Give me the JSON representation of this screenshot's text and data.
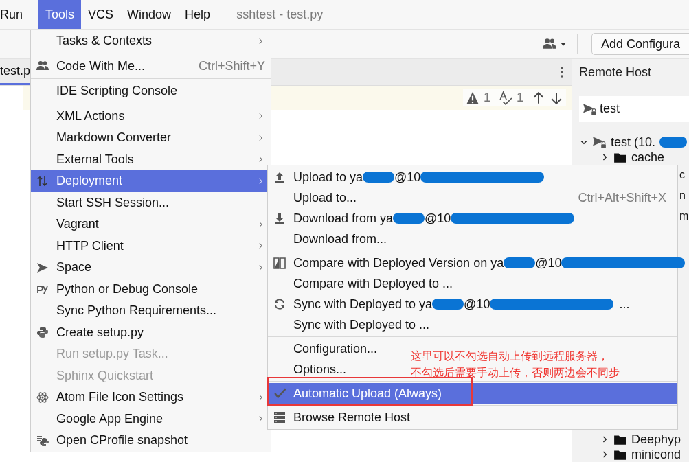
{
  "window": {
    "title": "sshtest - test.py"
  },
  "menubar": [
    {
      "label": "Run",
      "selected": false
    },
    {
      "label": "Tools",
      "selected": true
    },
    {
      "label": "VCS",
      "selected": false
    },
    {
      "label": "Window",
      "selected": false
    },
    {
      "label": "Help",
      "selected": false
    }
  ],
  "toolbar": {
    "run_config_button": "Add Configura"
  },
  "editor": {
    "tab": "test.p",
    "warnings": "1",
    "typos": "1"
  },
  "remote_host": {
    "title": "Remote Host",
    "server": "test",
    "tree": [
      {
        "label": "test (10.",
        "redacted": true,
        "expanded": true,
        "children": [
          {
            "label": "cache",
            "kind": "folder",
            "expanded": false
          },
          {
            "label": "c",
            "kind": "fragment"
          },
          {
            "label": "n",
            "kind": "fragment"
          },
          {
            "label": "m",
            "kind": "fragment"
          },
          {
            "label": "Deephyp",
            "kind": "folder",
            "expanded": false
          },
          {
            "label": "minicond",
            "kind": "folder",
            "expanded": false
          }
        ]
      }
    ]
  },
  "tools_menu": [
    {
      "kind": "item",
      "label": "Tasks & Contexts",
      "submenu": true,
      "selected": false,
      "disabled": false
    },
    {
      "kind": "separator"
    },
    {
      "kind": "item",
      "label": "Code With Me...",
      "shortcut": "Ctrl+Shift+Y",
      "submenu": false,
      "selected": false,
      "disabled": false
    },
    {
      "kind": "separator"
    },
    {
      "kind": "item",
      "label": "IDE Scripting Console",
      "submenu": false,
      "selected": false,
      "disabled": false
    },
    {
      "kind": "separator"
    },
    {
      "kind": "item",
      "label": "XML Actions",
      "submenu": true,
      "selected": false,
      "disabled": false
    },
    {
      "kind": "item",
      "label": "Markdown Converter",
      "submenu": true,
      "selected": false,
      "disabled": false
    },
    {
      "kind": "item",
      "label": "External Tools",
      "submenu": true,
      "selected": false,
      "disabled": false
    },
    {
      "kind": "item",
      "label": "Deployment",
      "submenu": true,
      "selected": true,
      "disabled": false
    },
    {
      "kind": "item",
      "label": "Start SSH Session...",
      "submenu": false,
      "selected": false,
      "disabled": false
    },
    {
      "kind": "item",
      "label": "Vagrant",
      "submenu": true,
      "selected": false,
      "disabled": false
    },
    {
      "kind": "item",
      "label": "HTTP Client",
      "submenu": true,
      "selected": false,
      "disabled": false
    },
    {
      "kind": "item",
      "label": "Space",
      "submenu": true,
      "selected": false,
      "disabled": false
    },
    {
      "kind": "item",
      "label": "Python or Debug Console",
      "submenu": false,
      "selected": false,
      "disabled": false
    },
    {
      "kind": "item",
      "label": "Sync Python Requirements...",
      "submenu": false,
      "selected": false,
      "disabled": false
    },
    {
      "kind": "item",
      "label": "Create setup.py",
      "submenu": false,
      "selected": false,
      "disabled": false
    },
    {
      "kind": "item",
      "label": "Run setup.py Task...",
      "submenu": false,
      "selected": false,
      "disabled": true
    },
    {
      "kind": "item",
      "label": "Sphinx Quickstart",
      "submenu": false,
      "selected": false,
      "disabled": true
    },
    {
      "kind": "item",
      "label": "Atom File Icon Settings",
      "submenu": true,
      "selected": false,
      "disabled": false
    },
    {
      "kind": "item",
      "label": "Google App Engine",
      "submenu": true,
      "selected": false,
      "disabled": false
    },
    {
      "kind": "item",
      "label": "Open CProfile snapshot",
      "submenu": false,
      "selected": false,
      "disabled": false
    }
  ],
  "deployment_menu": [
    {
      "kind": "item",
      "segments": [
        {
          "kind": "text",
          "text": "Upload to ya"
        },
        {
          "kind": "redaction"
        },
        {
          "kind": "text",
          "text": "@10"
        },
        {
          "kind": "redaction"
        }
      ],
      "selected": false,
      "checked": false
    },
    {
      "kind": "item",
      "segments": [
        {
          "kind": "text",
          "text": "Upload to..."
        }
      ],
      "shortcut": "Ctrl+Alt+Shift+X",
      "selected": false,
      "checked": false
    },
    {
      "kind": "item",
      "segments": [
        {
          "kind": "text",
          "text": "Download from ya"
        },
        {
          "kind": "redaction"
        },
        {
          "kind": "text",
          "text": "@10"
        },
        {
          "kind": "redaction"
        }
      ],
      "selected": false,
      "checked": false
    },
    {
      "kind": "item",
      "segments": [
        {
          "kind": "text",
          "text": "Download from..."
        }
      ],
      "selected": false,
      "checked": false
    },
    {
      "kind": "separator"
    },
    {
      "kind": "item",
      "segments": [
        {
          "kind": "text",
          "text": "Compare with Deployed Version on ya"
        },
        {
          "kind": "redaction"
        },
        {
          "kind": "text",
          "text": "@10"
        },
        {
          "kind": "redaction"
        }
      ],
      "selected": false,
      "checked": false
    },
    {
      "kind": "item",
      "segments": [
        {
          "kind": "text",
          "text": "Compare with Deployed to ..."
        }
      ],
      "selected": false,
      "checked": false
    },
    {
      "kind": "item",
      "segments": [
        {
          "kind": "text",
          "text": "Sync with Deployed to ya"
        },
        {
          "kind": "redaction"
        },
        {
          "kind": "text",
          "text": "@10"
        },
        {
          "kind": "redaction"
        },
        {
          "kind": "text",
          "text": "..."
        }
      ],
      "selected": false,
      "checked": false
    },
    {
      "kind": "item",
      "segments": [
        {
          "kind": "text",
          "text": "Sync with Deployed to ..."
        }
      ],
      "selected": false,
      "checked": false
    },
    {
      "kind": "separator"
    },
    {
      "kind": "item",
      "segments": [
        {
          "kind": "text",
          "text": "Configuration..."
        }
      ],
      "selected": false,
      "checked": false
    },
    {
      "kind": "item",
      "segments": [
        {
          "kind": "text",
          "text": "Options..."
        }
      ],
      "selected": false,
      "checked": false
    },
    {
      "kind": "separator"
    },
    {
      "kind": "item",
      "segments": [
        {
          "kind": "text",
          "text": "Automatic Upload (Always)"
        }
      ],
      "selected": true,
      "checked": true
    },
    {
      "kind": "separator"
    },
    {
      "kind": "item",
      "segments": [
        {
          "kind": "text",
          "text": "Browse Remote Host"
        }
      ],
      "selected": false,
      "checked": false
    }
  ],
  "annotation": {
    "lines": [
      "这里可以不勾选自动上传到远程服务器，",
      "不勾选后需要手动上传，否则两边会不同步"
    ]
  }
}
